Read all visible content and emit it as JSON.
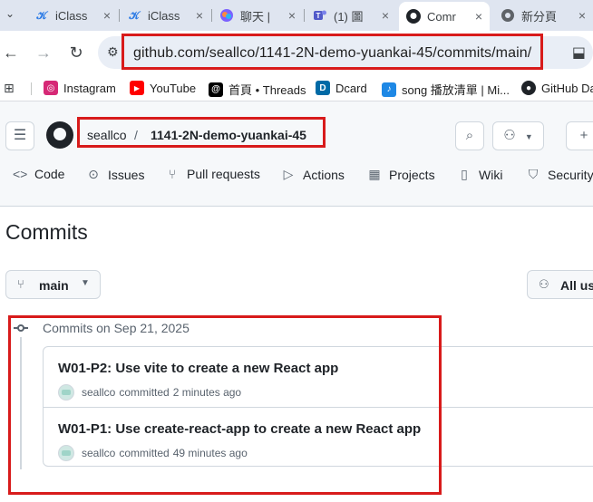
{
  "browser": {
    "tabs": [
      {
        "title": "iClass",
        "icon": "iclass-icon",
        "close": "×"
      },
      {
        "title": "iClass",
        "icon": "iclass-icon",
        "close": "×"
      },
      {
        "title": "聊天 |",
        "icon": "copilot-icon",
        "close": "×"
      },
      {
        "title": "(1) 圖",
        "icon": "teams-icon",
        "close": "×"
      },
      {
        "title": "Comr",
        "icon": "github-icon",
        "close": "×"
      },
      {
        "title": "新分頁",
        "icon": "chrome-icon",
        "close": "×"
      }
    ],
    "url": "github.com/seallco/1141-2N-demo-yuankai-45/commits/main/"
  },
  "bookmarks": [
    {
      "label": "Instagram",
      "icon": "instagram-icon",
      "color": "#d62976"
    },
    {
      "label": "YouTube",
      "icon": "youtube-icon",
      "color": "#ff0000"
    },
    {
      "label": "首頁 • Threads",
      "icon": "threads-icon",
      "color": "#000000"
    },
    {
      "label": "Dcard",
      "icon": "dcard-icon",
      "color": "#006aa6"
    },
    {
      "label": "song 播放清單 | Mi...",
      "icon": "music-icon",
      "color": "#1e88e5"
    },
    {
      "label": "GitHub Da",
      "icon": "github-icon",
      "color": "#1f2328"
    }
  ],
  "repo": {
    "owner": "seallco",
    "separator": "/",
    "name": "1141-2N-demo-yuankai-45"
  },
  "nav": [
    {
      "label": "Code",
      "icon": "code-icon"
    },
    {
      "label": "Issues",
      "icon": "issue-icon"
    },
    {
      "label": "Pull requests",
      "icon": "pull-request-icon"
    },
    {
      "label": "Actions",
      "icon": "play-icon"
    },
    {
      "label": "Projects",
      "icon": "table-icon"
    },
    {
      "label": "Wiki",
      "icon": "book-icon"
    },
    {
      "label": "Security",
      "icon": "shield-icon"
    }
  ],
  "page": {
    "title": "Commits",
    "branch": "main",
    "users_filter": "All us"
  },
  "commit_group": {
    "label": "Commits on Sep 21, 2025",
    "commits": [
      {
        "message": "W01-P2: Use vite to create a new React app",
        "author": "seallco",
        "verb": "committed",
        "time": "2 minutes ago"
      },
      {
        "message": "W01-P1: Use create-react-app to create a new React app",
        "author": "seallco",
        "verb": "committed",
        "time": "49 minutes ago"
      }
    ]
  },
  "colors": {
    "annotation": "#d81b1b",
    "github_text": "#1f2328",
    "muted": "#59636e"
  }
}
